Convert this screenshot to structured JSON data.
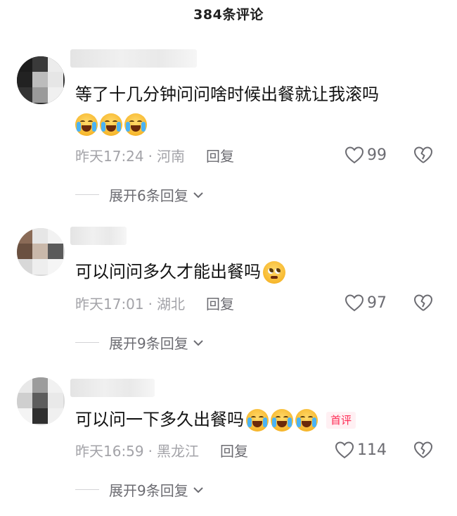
{
  "header": {
    "title": "384条评论"
  },
  "comments": [
    {
      "text": "等了十几分钟问问啥时候出餐就让我滚吗",
      "emoji": "loudly-crying-emoji",
      "time": "昨天17:24",
      "location": "河南",
      "reply_label": "回复",
      "likes": "99",
      "expand_label": "展开6条回复"
    },
    {
      "text": "可以问问多久才能出餐吗",
      "emoji": "pleading-face-emoji",
      "time": "昨天17:01",
      "location": "湖北",
      "reply_label": "回复",
      "likes": "97",
      "expand_label": "展开9条回复"
    },
    {
      "text": "可以问一下多久出餐吗",
      "emoji": "loudly-crying-emoji",
      "badge": "首评",
      "time": "昨天16:59",
      "location": "黑龙江",
      "reply_label": "回复",
      "likes": "114",
      "expand_label": "展开9条回复"
    }
  ],
  "separator": "·",
  "colors": {
    "accent": "#fe2c55",
    "meta": "#a3a3a8",
    "text": "#111111"
  }
}
